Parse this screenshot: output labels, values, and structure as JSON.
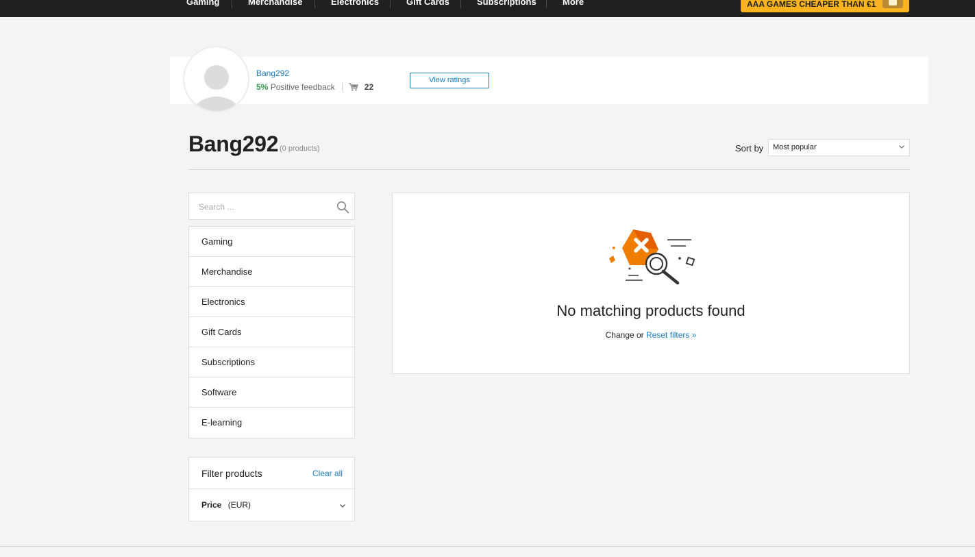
{
  "topnav": {
    "items": [
      "Gaming",
      "Merchandise",
      "Electronics",
      "Gift Cards",
      "Subscriptions",
      "More"
    ],
    "promo": "AAA GAMES CHEAPER THAN €1"
  },
  "seller": {
    "name": "Bang292",
    "feedback_pct": "5%",
    "feedback_label": "Positive feedback",
    "sales_count": "22",
    "view_ratings": "View ratings"
  },
  "header": {
    "title": "Bang292",
    "product_count": "(0 products)",
    "sort_label": "Sort by",
    "sort_value": "Most popular"
  },
  "sidebar": {
    "search_placeholder": "Search ...",
    "categories": [
      "Gaming",
      "Merchandise",
      "Electronics",
      "Gift Cards",
      "Subscriptions",
      "Software",
      "E-learning"
    ],
    "filter_title": "Filter products",
    "clear_all": "Clear all",
    "price_label": "Price",
    "price_currency": "(EUR)"
  },
  "empty_state": {
    "title": "No matching products found",
    "sub_prefix": "Change or",
    "reset_link": "Reset filters »"
  },
  "colors": {
    "accent_blue": "#1a7bbf",
    "promo_yellow": "#fbb41f",
    "positive_green": "#3a9b4b",
    "illustration_orange": "#f07d00",
    "nav_dark": "#202020"
  },
  "icons": [
    "search-icon",
    "cart-icon",
    "chevron-down-icon",
    "no-results-illustration"
  ]
}
